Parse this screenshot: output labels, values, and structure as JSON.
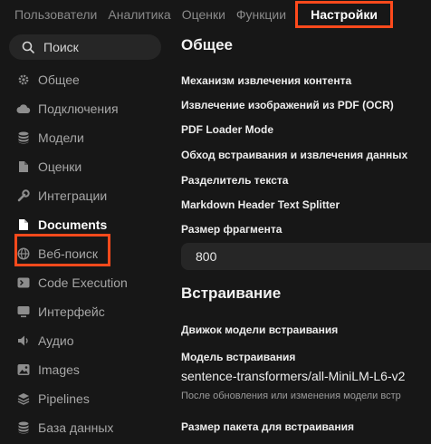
{
  "tabs": [
    "Пользователи",
    "Аналитика",
    "Оценки",
    "Функции",
    "Настройки"
  ],
  "active_tab": "Настройки",
  "sidebar": {
    "search_placeholder": "Поиск",
    "items": [
      {
        "label": "Общее",
        "icon": "gear-icon"
      },
      {
        "label": "Подключения",
        "icon": "cloud-icon"
      },
      {
        "label": "Модели",
        "icon": "database-icon"
      },
      {
        "label": "Оценки",
        "icon": "document-icon"
      },
      {
        "label": "Интеграции",
        "icon": "wrench-icon"
      },
      {
        "label": "Documents",
        "icon": "folder-icon"
      },
      {
        "label": "Веб-поиск",
        "icon": "globe-icon"
      },
      {
        "label": "Code Execution",
        "icon": "terminal-icon"
      },
      {
        "label": "Интерфейс",
        "icon": "monitor-icon"
      },
      {
        "label": "Аудио",
        "icon": "speaker-icon"
      },
      {
        "label": "Images",
        "icon": "image-icon"
      },
      {
        "label": "Pipelines",
        "icon": "stack-icon"
      },
      {
        "label": "База данных",
        "icon": "database-icon"
      }
    ],
    "active_item": "Documents"
  },
  "main": {
    "general_title": "Общее",
    "settings": [
      "Механизм извлечения контента",
      "Извлечение изображений из PDF (OCR)",
      "PDF Loader Mode",
      "Обход встраивания и извлечения данных",
      "Разделитель текста",
      "Markdown Header Text Splitter",
      "Размер фрагмента"
    ],
    "chunk_size_value": "800",
    "embedding_title": "Встраивание",
    "embedding_engine_label": "Движок модели встраивания",
    "embedding_model_label": "Модель встраивания",
    "embedding_model_value": "sentence-transformers/all-MiniLM-L6-v2",
    "embedding_hint": "После обновления или изменения модели встр",
    "batch_size_label": "Размер пакета для встраивания"
  },
  "colors": {
    "accent_highlight": "#ff4a1c",
    "background": "#171717",
    "input": "#262626"
  }
}
